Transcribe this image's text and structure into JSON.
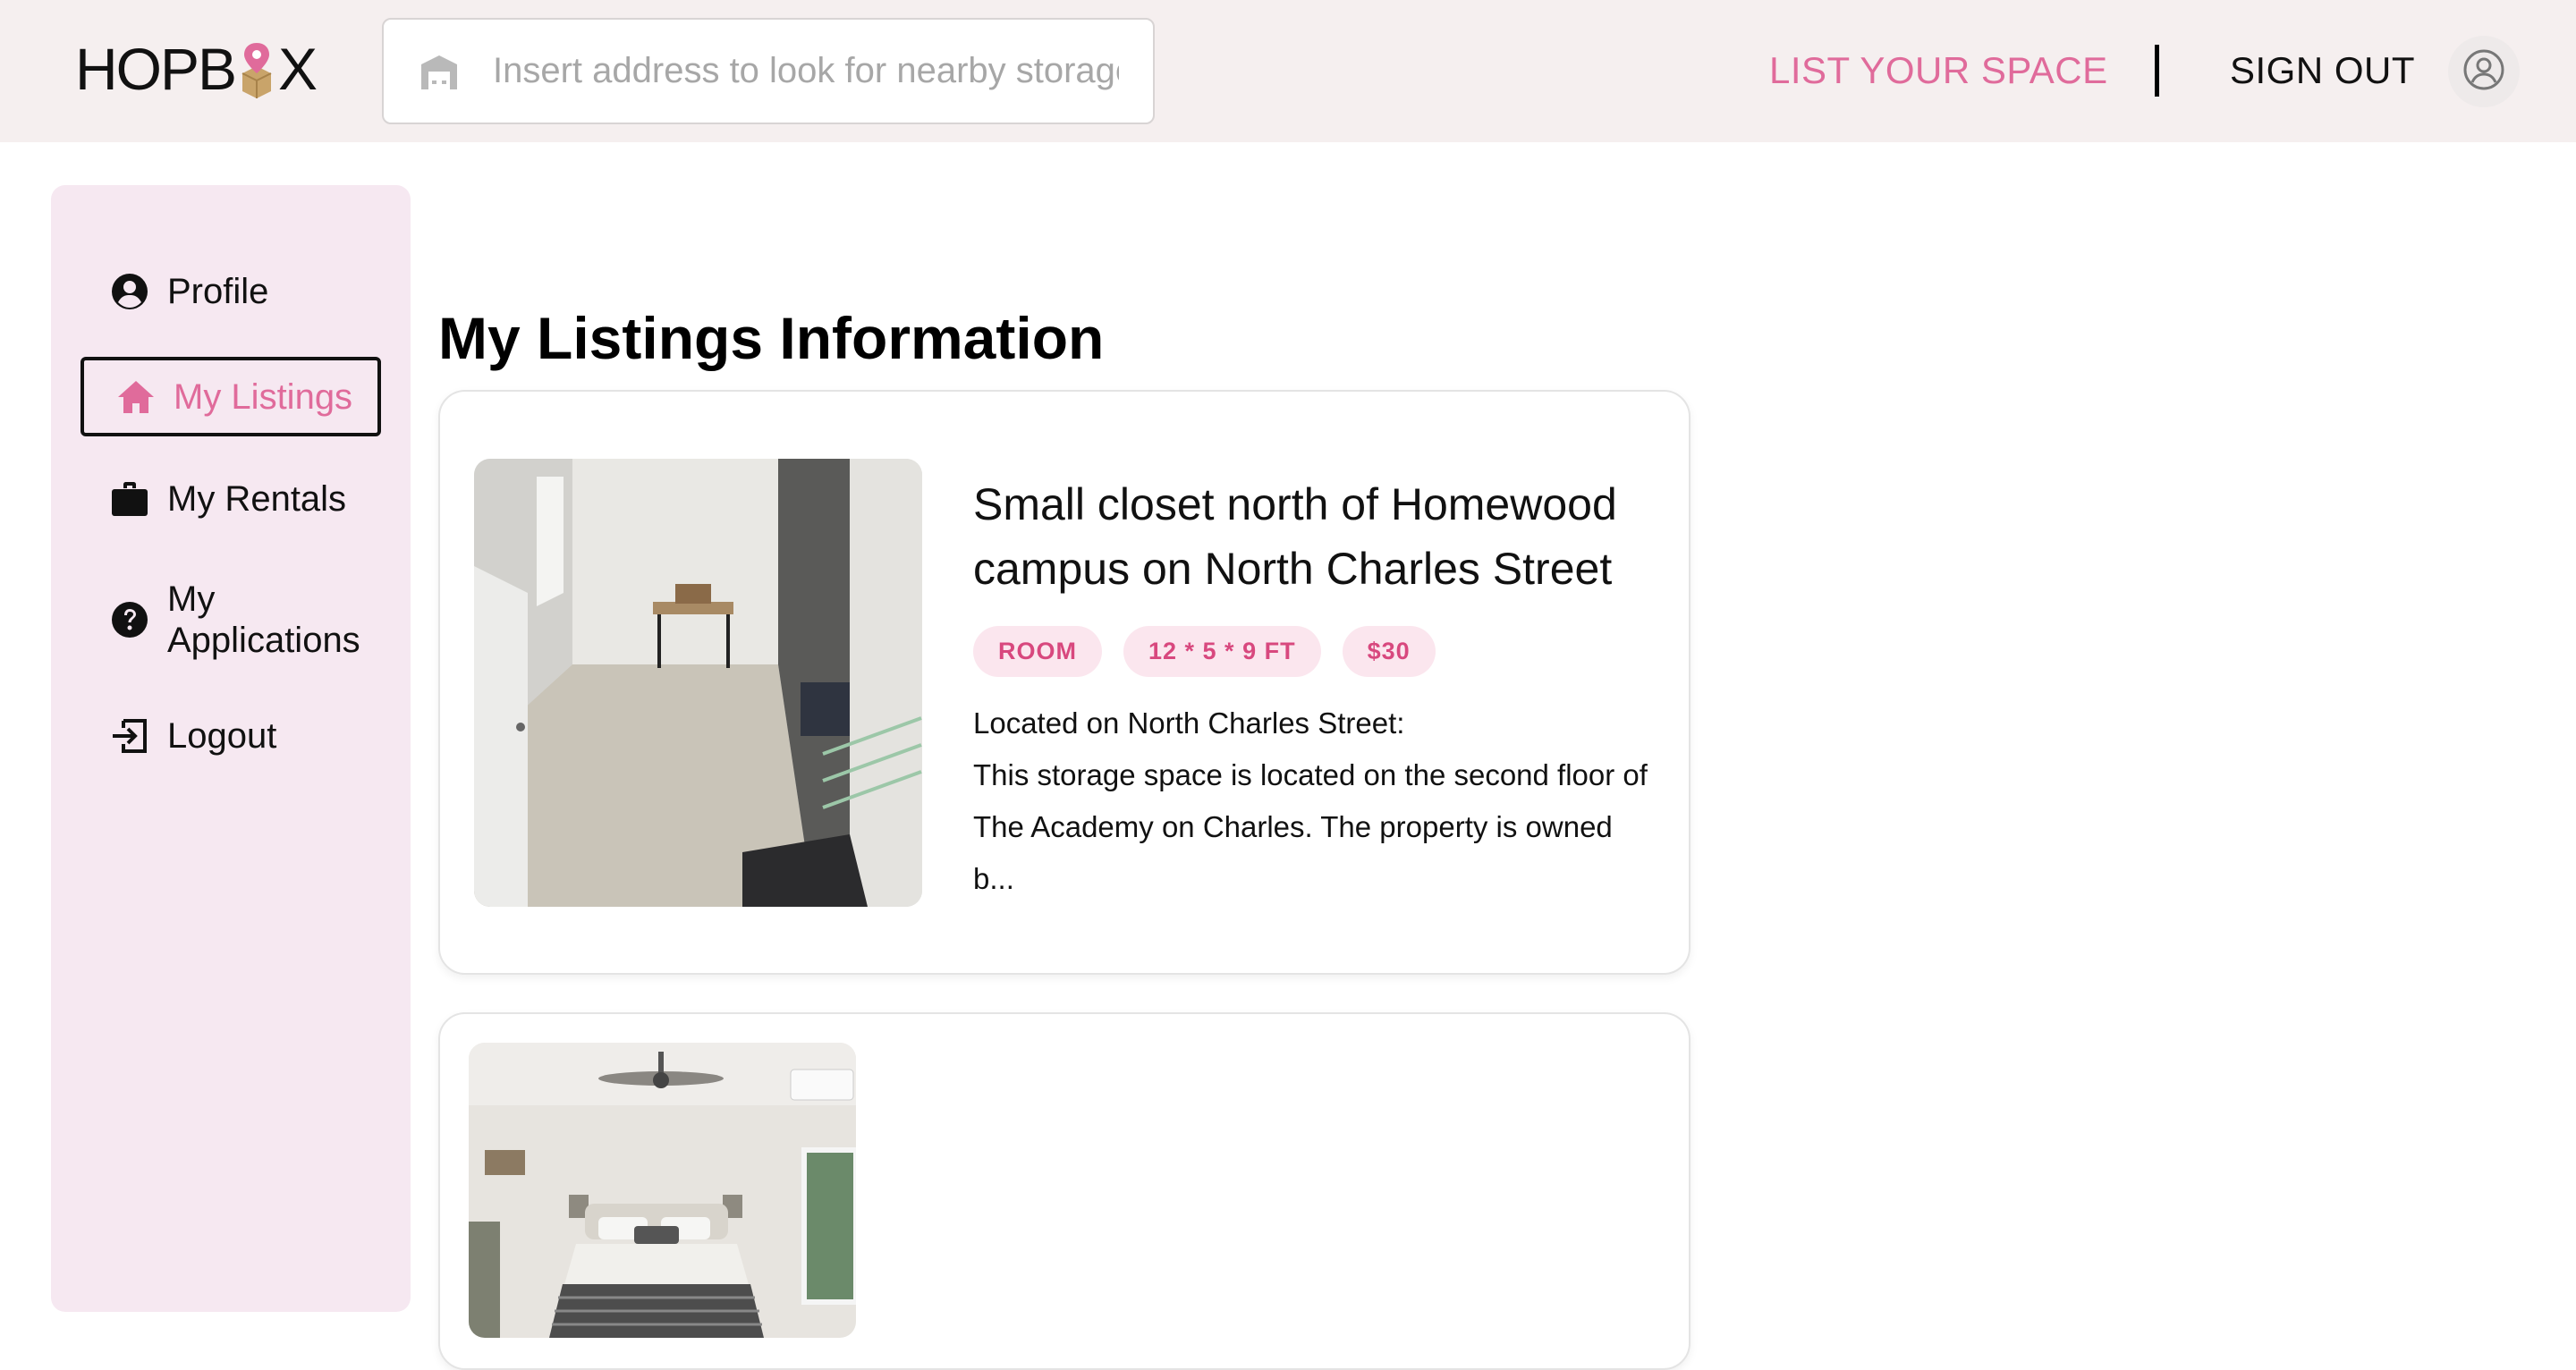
{
  "header": {
    "logo_text_left": "HOPB",
    "logo_text_right": "X",
    "search_placeholder": "Insert address to look for nearby storage",
    "list_space_label": "LIST YOUR SPACE",
    "signout_label": "SIGN OUT",
    "search_icon": "garage-icon",
    "avatar_icon": "user-circle-icon"
  },
  "sidebar": {
    "items": [
      {
        "label": "Profile",
        "icon": "user-circle-icon"
      },
      {
        "label": "My Listings",
        "icon": "home-icon",
        "active": true
      },
      {
        "label": "My Rentals",
        "icon": "briefcase-icon"
      },
      {
        "label": "My Applications",
        "icon": "question-circle-icon"
      },
      {
        "label": "Logout",
        "icon": "logout-icon"
      }
    ]
  },
  "main": {
    "title": "My Listings Information",
    "listings": [
      {
        "title": "Small closet north of Homewood campus on North Charles Street",
        "tags": [
          "ROOM",
          "12 * 5 * 9 FT",
          "$30"
        ],
        "description_line1": "Located on North Charles Street:",
        "description_rest": "This storage space is located on the second floor of The Academy on Charles. The property is owned b..."
      },
      {
        "title": "",
        "tags": []
      }
    ]
  },
  "colors": {
    "accent": "#e06b9b",
    "header_bg": "#f5efef",
    "sidebar_bg": "#f6e8f1",
    "tag_bg": "#fbe6ee",
    "tag_text": "#d8487e"
  }
}
